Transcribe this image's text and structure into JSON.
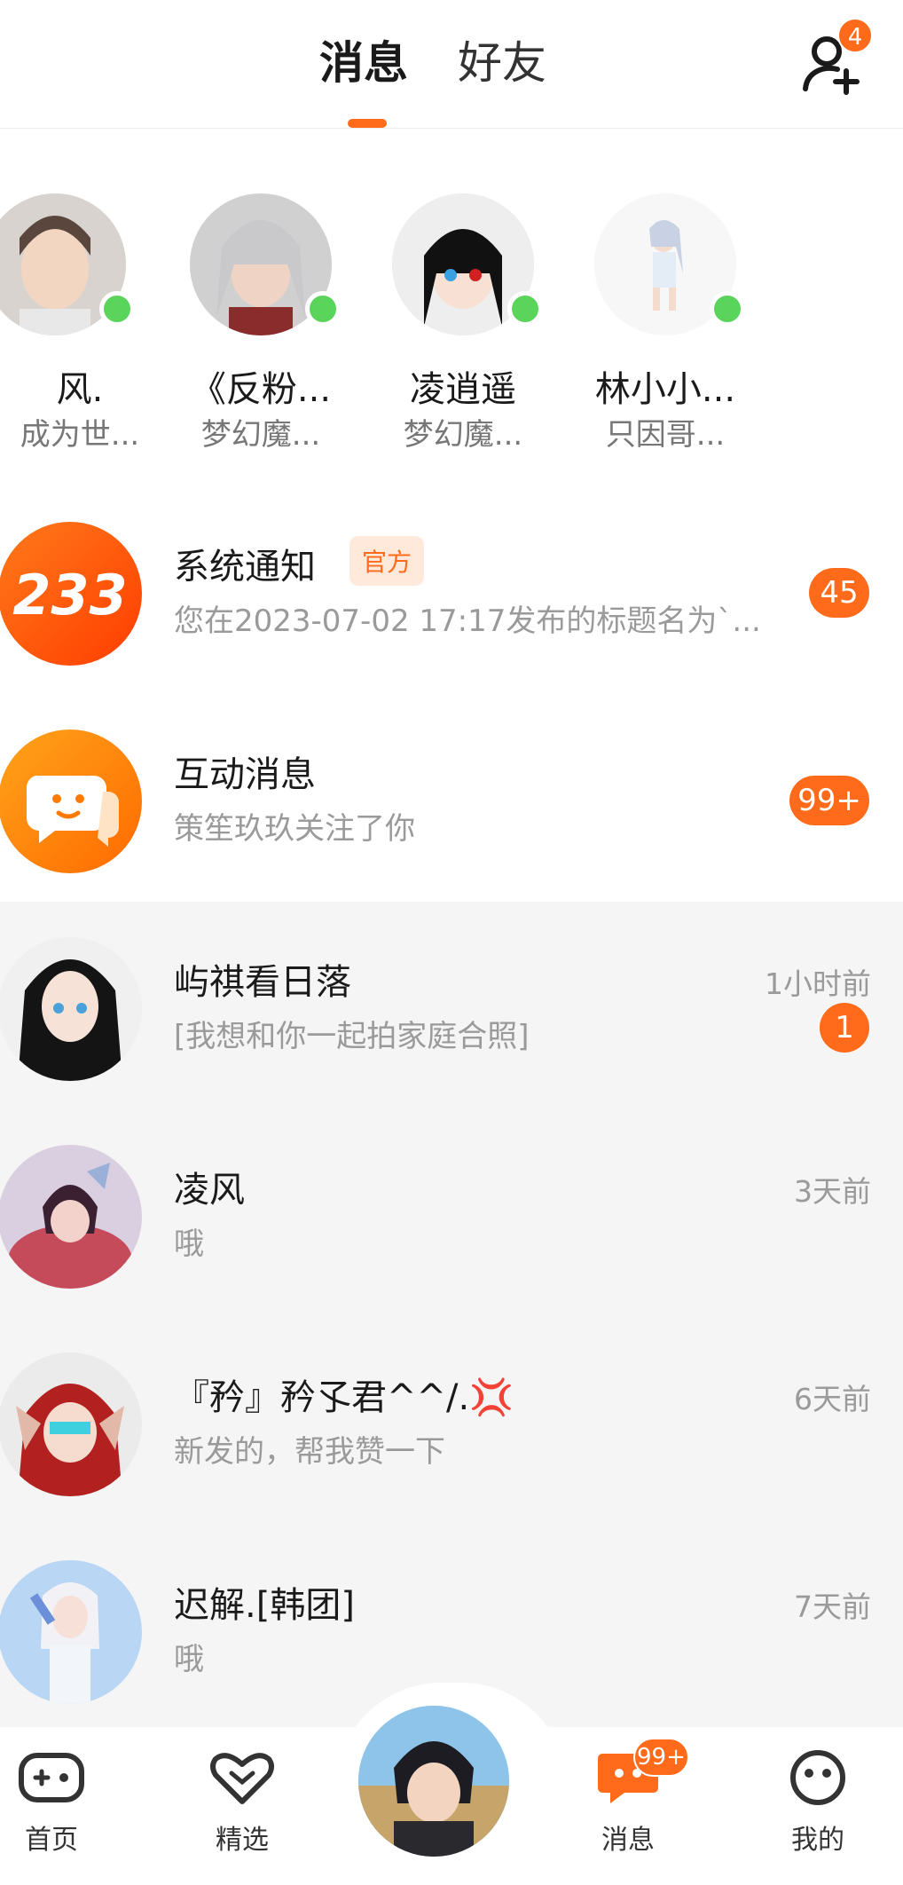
{
  "header": {
    "tabs": [
      "消息",
      "好友"
    ],
    "friend_requests_badge": "4",
    "accent_color": "#ff6b1a"
  },
  "online_friends": [
    {
      "name": "风.",
      "subtitle": "成为世..."
    },
    {
      "name": "《反粉...",
      "subtitle": "梦幻魔..."
    },
    {
      "name": "凌逍遥",
      "subtitle": "梦幻魔..."
    },
    {
      "name": "林小小...",
      "subtitle": "只因哥..."
    }
  ],
  "system": {
    "logo_text": "233",
    "title": "系统通知",
    "tag": "官方",
    "preview": "您在2023-07-02 17:17发布的标题名为`...",
    "count": "45"
  },
  "interaction": {
    "title": "互动消息",
    "preview": "策笙玖玖关注了你",
    "count": "99+"
  },
  "conversations": [
    {
      "name": "屿祺看日落",
      "preview": "[我想和你一起拍家庭合照]",
      "time": "1小时前",
      "unread": "1"
    },
    {
      "name": "凌风",
      "preview": "哦",
      "time": "3天前"
    },
    {
      "name": "『矜』矜孓君^^/.💢",
      "preview": "新发的，帮我赞一下",
      "time": "6天前"
    },
    {
      "name": "迟解.[韩团]",
      "preview": "哦",
      "time": "7天前"
    }
  ],
  "bottom_nav": {
    "home": "首页",
    "featured": "精选",
    "messages": "消息",
    "messages_badge": "99+",
    "mine": "我的"
  }
}
